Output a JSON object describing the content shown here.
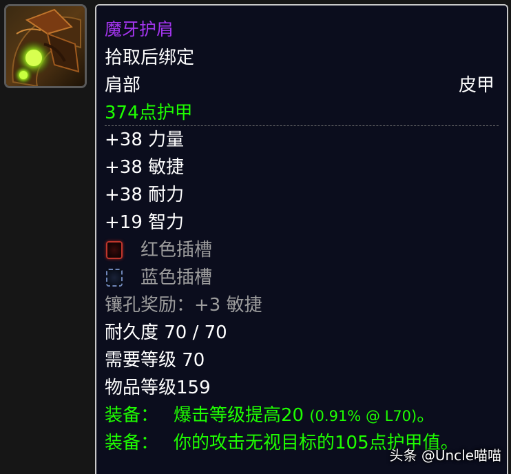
{
  "item": {
    "icon": "shoulder-armor-icon",
    "name": "魔牙护肩",
    "binding": "拾取后绑定",
    "slot": "肩部",
    "armor_type": "皮甲",
    "armor": "374点护甲",
    "stats": [
      "+38 力量",
      "+38 敏捷",
      "+38 耐力",
      "+19 智力"
    ],
    "sockets": [
      {
        "color": "red",
        "label": "红色插槽"
      },
      {
        "color": "blue",
        "label": "蓝色插槽"
      }
    ],
    "socket_bonus": "镶孔奖励：+3 敏捷",
    "durability": "耐久度 70 / 70",
    "required_level": "需要等级 70",
    "item_level": "物品等级159",
    "equip_effects": [
      {
        "label": "装备：",
        "text": "爆击等级提高20",
        "note": "(0.91% @ L70)",
        "end": "。"
      },
      {
        "label": "装备：",
        "text": "你的攻击无视目标的105点护甲值。",
        "note": "",
        "end": ""
      }
    ]
  },
  "colors": {
    "epic": "#a335ee",
    "white": "#ffffff",
    "green": "#1eff00",
    "gray": "#9d9d9d",
    "background": "#0b0d1d",
    "border": "#c9c9c9"
  },
  "watermark": "头条 @Uncle喵喵"
}
